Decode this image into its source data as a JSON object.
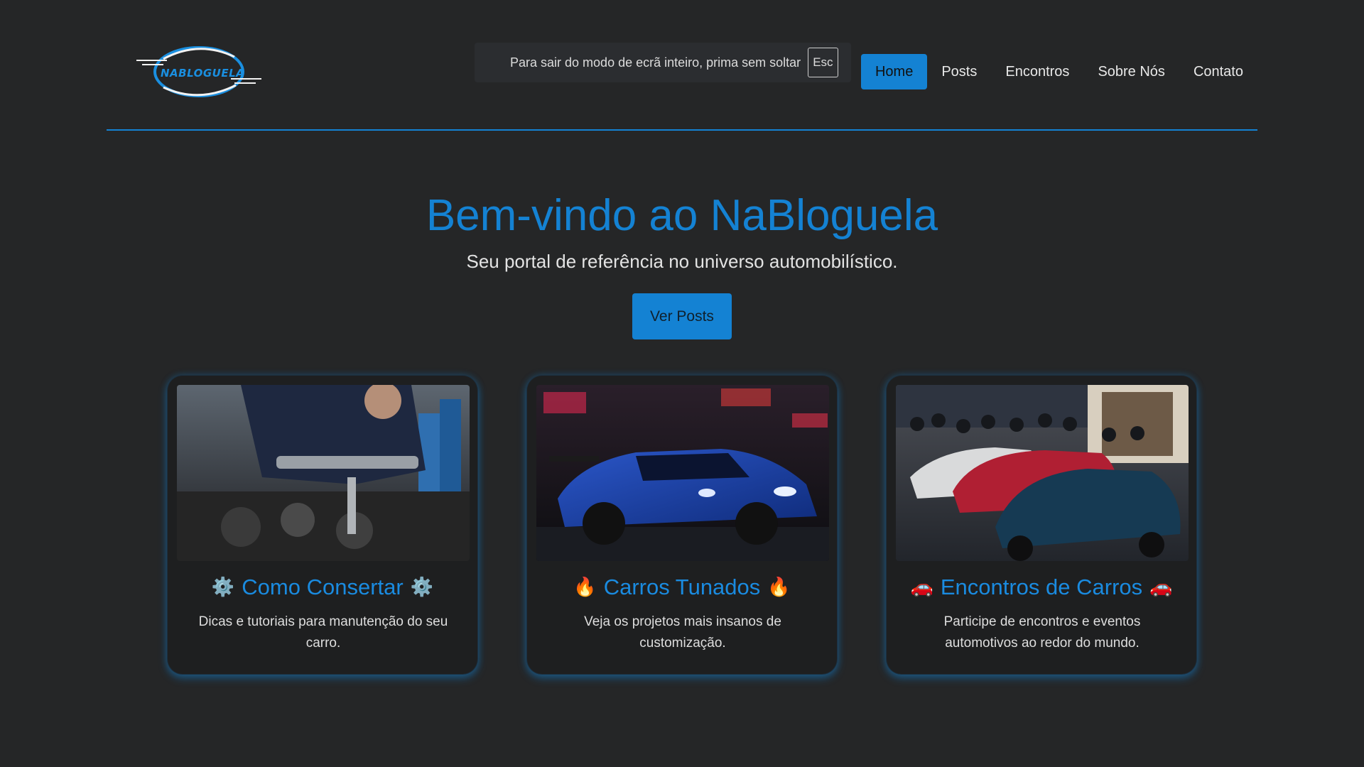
{
  "header": {
    "logo_text": "NABLOGUELA",
    "nav": [
      {
        "label": "Home",
        "active": true
      },
      {
        "label": "Posts"
      },
      {
        "label": "Encontros"
      },
      {
        "label": "Sobre Nós"
      },
      {
        "label": "Contato"
      }
    ]
  },
  "fullscreen_notice": {
    "message": "Para sair do modo de ecrã inteiro, prima sem soltar",
    "key": "Esc"
  },
  "hero": {
    "title": "Bem-vindo ao NaBloguela",
    "subtitle": "Seu portal de referência no universo automobilístico.",
    "button": "Ver Posts"
  },
  "cards": [
    {
      "emoji": "⚙️",
      "title": "Como Consertar",
      "description": "Dicas e tutoriais para manutenção do seu carro.",
      "image": "mechanic-repairing-engine-photo"
    },
    {
      "emoji": "🔥",
      "title": "Carros Tunados",
      "description": "Veja os projetos mais insanos de customização.",
      "image": "blue-tuned-car-night-photo"
    },
    {
      "emoji": "🚗",
      "title": "Encontros de Carros",
      "description": "Participe de encontros e eventos automotivos ao redor do mundo.",
      "image": "car-meet-crowd-photo"
    }
  ],
  "colors": {
    "background": "#252627",
    "accent": "#1482d3",
    "card_background": "#1e1f20"
  }
}
